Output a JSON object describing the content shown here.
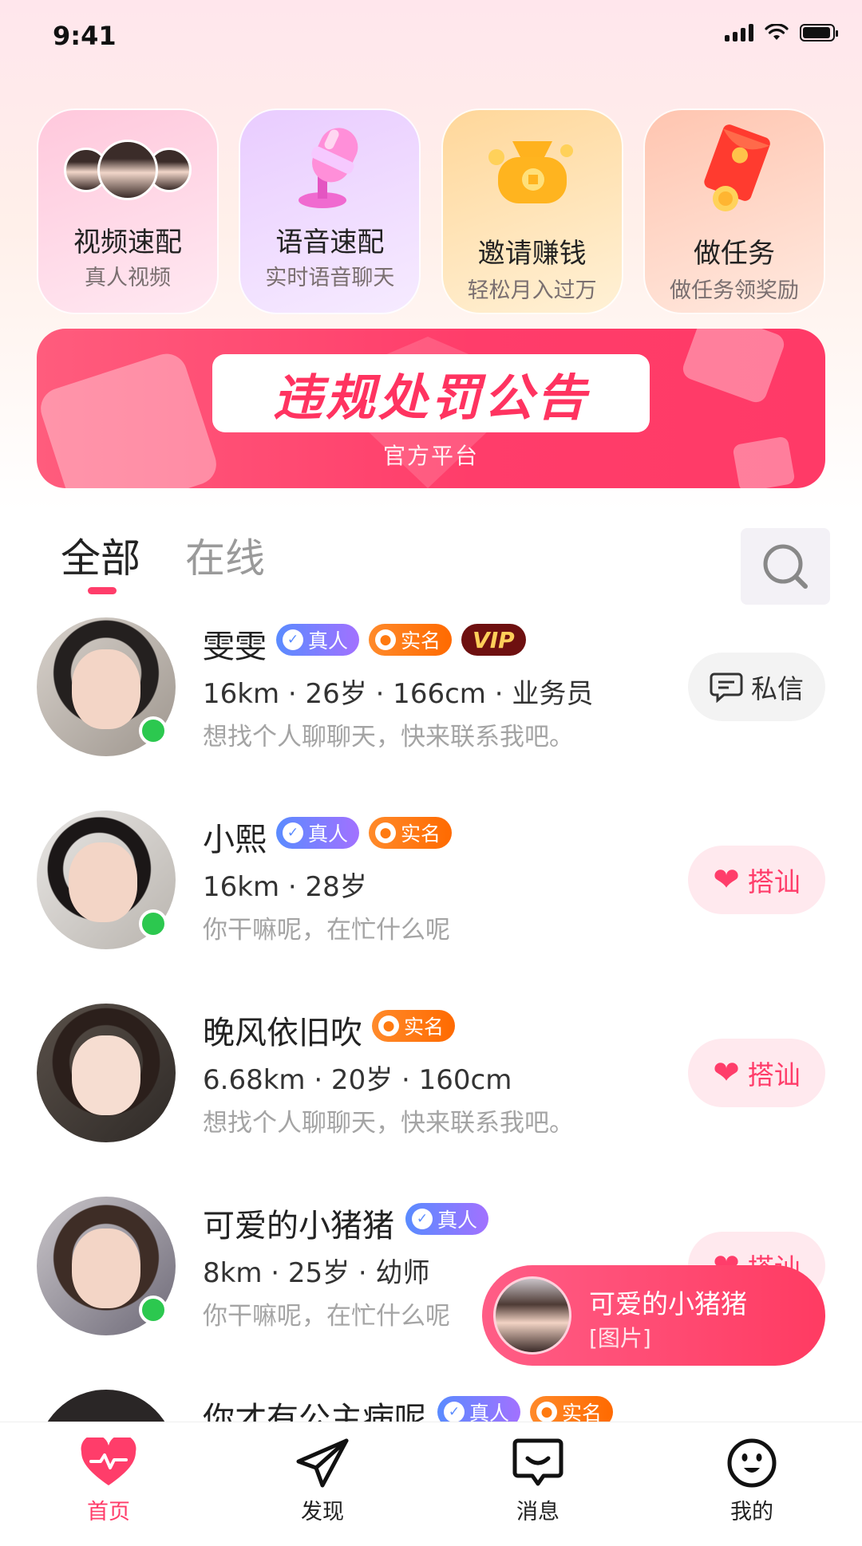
{
  "status_bar": {
    "time": "9:41"
  },
  "features": [
    {
      "title": "视频速配",
      "subtitle": "真人视频"
    },
    {
      "title": "语音速配",
      "subtitle": "实时语音聊天"
    },
    {
      "title": "邀请赚钱",
      "subtitle": "轻松月入过万"
    },
    {
      "title": "做任务",
      "subtitle": "做任务领奖励"
    }
  ],
  "banner": {
    "title": "违规处罚公告",
    "subtitle": "官方平台"
  },
  "tabs": {
    "all": "全部",
    "online": "在线"
  },
  "badges": {
    "real": "真人",
    "realname": "实名",
    "vip": "VIP"
  },
  "users": [
    {
      "name": "雯雯",
      "meta": "16km · 26岁 · 166cm · 业务员",
      "bio": "想找个人聊聊天，快来联系我吧。",
      "action": "私信"
    },
    {
      "name": "小熙",
      "meta": "16km · 28岁",
      "bio": "你干嘛呢，在忙什么呢",
      "action": "搭讪"
    },
    {
      "name": "晚风依旧吹",
      "meta": "6.68km · 20岁 · 160cm",
      "bio": "想找个人聊聊天，快来联系我吧。",
      "action": "搭讪"
    },
    {
      "name": "可爱的小猪猪",
      "meta": "8km · 25岁 · 幼师",
      "bio": "你干嘛呢，在忙什么呢",
      "action": "搭讪"
    },
    {
      "name": "你才有公主病呢"
    }
  ],
  "toast": {
    "name": "可爱的小猪猪",
    "message": "[图片]"
  },
  "tabbar": [
    {
      "label": "首页",
      "icon": "heart-pulse-icon"
    },
    {
      "label": "发现",
      "icon": "paper-plane-icon"
    },
    {
      "label": "消息",
      "icon": "chat-bubble-icon"
    },
    {
      "label": "我的",
      "icon": "smiley-icon"
    }
  ],
  "colors": {
    "accent": "#ff3d6a",
    "online": "#2cc84f"
  }
}
